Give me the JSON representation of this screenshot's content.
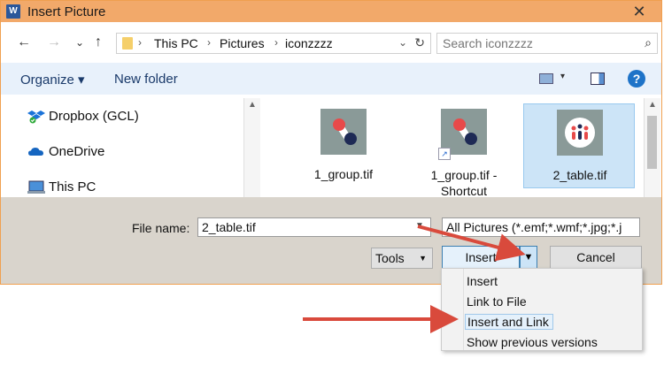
{
  "window": {
    "title": "Insert Picture",
    "app_icon_letter": "W",
    "close_glyph": "✕"
  },
  "nav": {
    "back": "←",
    "forward": "→",
    "recent": "⌄",
    "up": "↑"
  },
  "address": {
    "crumbs": [
      "This PC",
      "Pictures",
      "iconzzzz"
    ],
    "separator": "›"
  },
  "search": {
    "placeholder": "Search iconzzzz"
  },
  "toolbar": {
    "organize": "Organize ▾",
    "new_folder": "New folder",
    "help": "?"
  },
  "navpane": {
    "items": [
      "Dropbox (GCL)",
      "OneDrive",
      "This PC"
    ]
  },
  "files": [
    {
      "name": "1_group.tif"
    },
    {
      "name": "1_group.tif - Shortcut"
    },
    {
      "name": "2_table.tif"
    }
  ],
  "bottom": {
    "file_name_label": "File name:",
    "file_name_value": "2_table.tif",
    "file_type": "All Pictures (*.emf;*.wmf;*.jpg;*.j",
    "tools": "Tools",
    "insert": "Insert",
    "cancel": "Cancel"
  },
  "insert_menu": {
    "items": [
      "Insert",
      "Link to File",
      "Insert and Link",
      "Show previous versions"
    ]
  },
  "colors": {
    "titlebar": "#f2a96a",
    "accent": "#1e73c8",
    "annotation_arrow": "#d94a3c"
  }
}
